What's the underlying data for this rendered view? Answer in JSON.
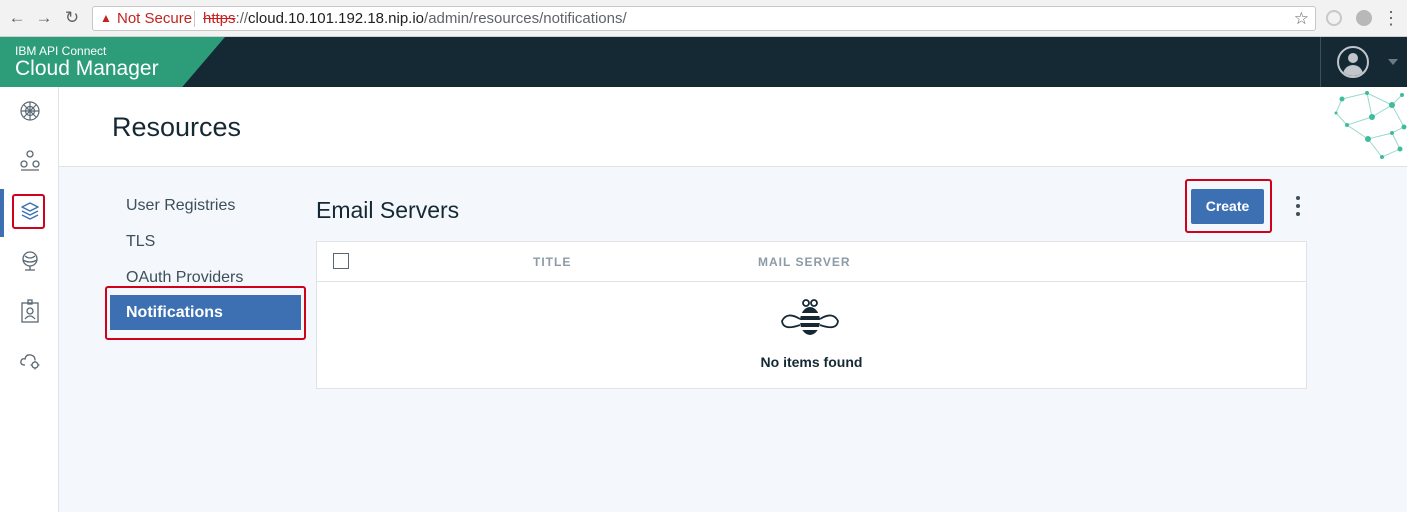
{
  "browser": {
    "security_label": "Not Secure",
    "url_scheme": "https",
    "url_separator": "://",
    "url_host": "cloud.10.101.192.18.nip.io",
    "url_path": "/admin/resources/notifications/"
  },
  "header": {
    "brand_top": "IBM API Connect",
    "brand_main": "Cloud Manager"
  },
  "rail": {
    "items": [
      "dashboard-icon",
      "topology-icon",
      "resources-icon",
      "provider-orgs-icon",
      "members-icon",
      "settings-icon"
    ],
    "active_index": 2
  },
  "page": {
    "title": "Resources"
  },
  "subnav": {
    "items": [
      {
        "label": "User Registries"
      },
      {
        "label": "TLS"
      },
      {
        "label": "OAuth Providers"
      },
      {
        "label": "Notifications"
      }
    ],
    "active": "Notifications"
  },
  "content": {
    "section_title": "Email Servers",
    "create_label": "Create",
    "table": {
      "columns": [
        "TITLE",
        "MAIL SERVER"
      ],
      "empty_text": "No items found"
    }
  },
  "colors": {
    "brand_green": "#2c9d78",
    "header_dark": "#152935",
    "primary_blue": "#3d70b2",
    "highlight_red": "#d0021b"
  }
}
